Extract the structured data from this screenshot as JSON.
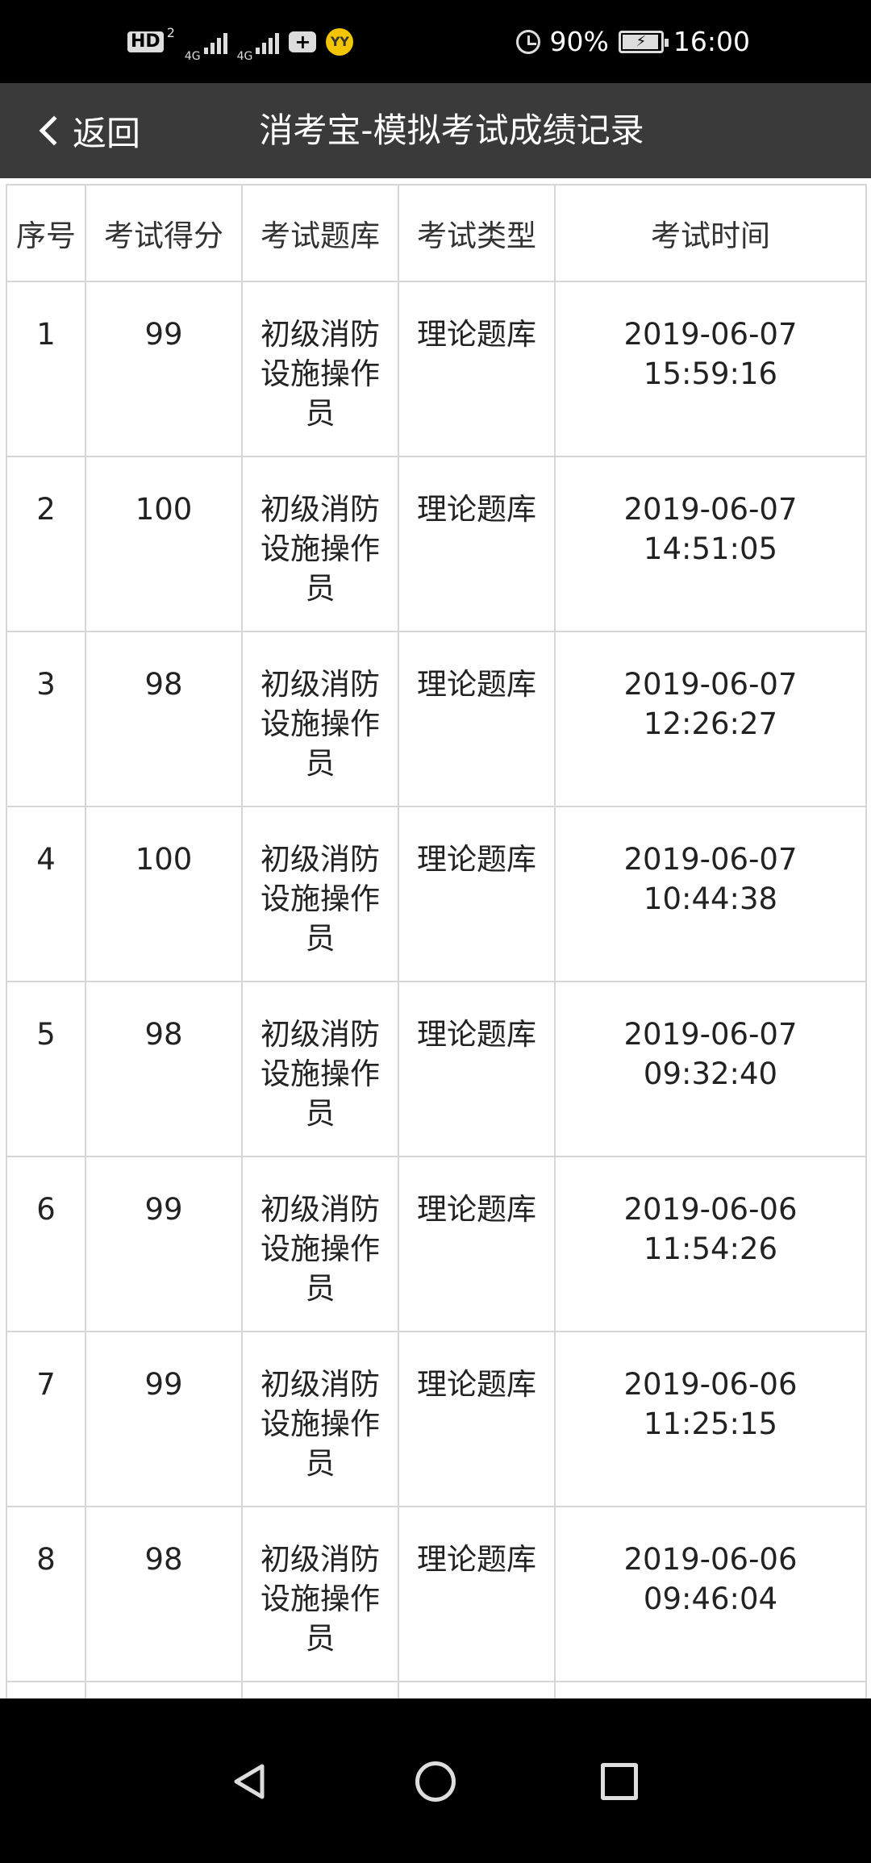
{
  "status_bar": {
    "hd_label": "HD",
    "hd_sub": "2",
    "net1": "4G",
    "net2": "4G",
    "yy_label": "YY",
    "battery_percent": "90%",
    "time": "16:00"
  },
  "header": {
    "back_label": "返回",
    "title": "消考宝-模拟考试成绩记录"
  },
  "table": {
    "columns": [
      "序号",
      "考试得分",
      "考试题库",
      "考试类型",
      "考试时间"
    ],
    "rows": [
      {
        "index": "1",
        "score": "99",
        "bank": "初级消防设施操作员",
        "type": "理论题库",
        "date": "2019-06-07",
        "time": "15:59:16"
      },
      {
        "index": "2",
        "score": "100",
        "bank": "初级消防设施操作员",
        "type": "理论题库",
        "date": "2019-06-07",
        "time": "14:51:05"
      },
      {
        "index": "3",
        "score": "98",
        "bank": "初级消防设施操作员",
        "type": "理论题库",
        "date": "2019-06-07",
        "time": "12:26:27"
      },
      {
        "index": "4",
        "score": "100",
        "bank": "初级消防设施操作员",
        "type": "理论题库",
        "date": "2019-06-07",
        "time": "10:44:38"
      },
      {
        "index": "5",
        "score": "98",
        "bank": "初级消防设施操作员",
        "type": "理论题库",
        "date": "2019-06-07",
        "time": "09:32:40"
      },
      {
        "index": "6",
        "score": "99",
        "bank": "初级消防设施操作员",
        "type": "理论题库",
        "date": "2019-06-06",
        "time": "11:54:26"
      },
      {
        "index": "7",
        "score": "99",
        "bank": "初级消防设施操作员",
        "type": "理论题库",
        "date": "2019-06-06",
        "time": "11:25:15"
      },
      {
        "index": "8",
        "score": "98",
        "bank": "初级消防设施操作员",
        "type": "理论题库",
        "date": "2019-06-06",
        "time": "09:46:04"
      }
    ]
  },
  "icons": {
    "back": "chevron-left-icon",
    "nav_back": "triangle-back-icon",
    "nav_home": "circle-home-icon",
    "nav_recent": "square-recent-icon"
  }
}
